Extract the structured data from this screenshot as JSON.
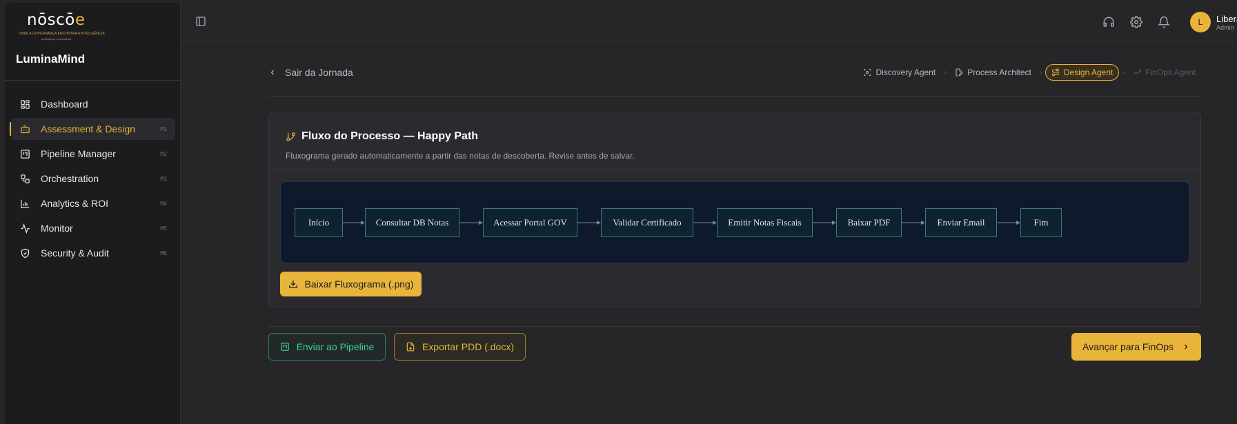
{
  "logo": {
    "word_pre": "nōscō",
    "word_accent": "e",
    "tagline": "ONDE A GOVERNANÇA ENCONTRA A INTELIGÊNCIA",
    "sub": "Inteligência LuminaMind"
  },
  "brand": "LuminaMind",
  "sidebar": {
    "items": [
      {
        "label": "Dashboard",
        "key": "",
        "icon": "dashboard-icon"
      },
      {
        "label": "Assessment & Design",
        "key": "M1",
        "icon": "bot-icon",
        "active": true
      },
      {
        "label": "Pipeline Manager",
        "key": "M2",
        "icon": "kanban-icon"
      },
      {
        "label": "Orchestration",
        "key": "M3",
        "icon": "workflow-icon"
      },
      {
        "label": "Analytics & ROI",
        "key": "M4",
        "icon": "bar-chart-icon"
      },
      {
        "label": "Monitor",
        "key": "M5",
        "icon": "activity-icon"
      },
      {
        "label": "Security & Audit",
        "key": "M6",
        "icon": "shield-icon"
      }
    ]
  },
  "user": {
    "initial": "L",
    "name": "Liberato",
    "role": "Admin"
  },
  "journey": {
    "back_label": "Sair da Jornada",
    "steps": [
      {
        "label": "Discovery Agent",
        "state": "done"
      },
      {
        "label": "Process Architect",
        "state": "done"
      },
      {
        "label": "Design Agent",
        "state": "active"
      },
      {
        "label": "FinOps Agent",
        "state": "pending"
      }
    ]
  },
  "card": {
    "title": "Fluxo do Processo — Happy Path",
    "subtitle": "Fluxograma gerado automaticamente a partir das notas de descoberta. Revise antes de salvar.",
    "download_label": "Baixar Fluxograma (.png)"
  },
  "flow": {
    "nodes": [
      "Início",
      "Consultar DB Notas",
      "Acessar Portal GOV",
      "Validar Certificado",
      "Emitir Notas Fiscais",
      "Baixar PDF",
      "Enviar Email",
      "Fim"
    ]
  },
  "actions": {
    "pipeline_label": "Enviar ao Pipeline",
    "export_label": "Exportar PDD (.docx)",
    "next_label": "Avançar para FinOps"
  },
  "colors": {
    "accent": "#e8b53a",
    "success": "#3bd08e",
    "flow_bg": "#0e1a2c",
    "node_border": "#3a7a78"
  }
}
